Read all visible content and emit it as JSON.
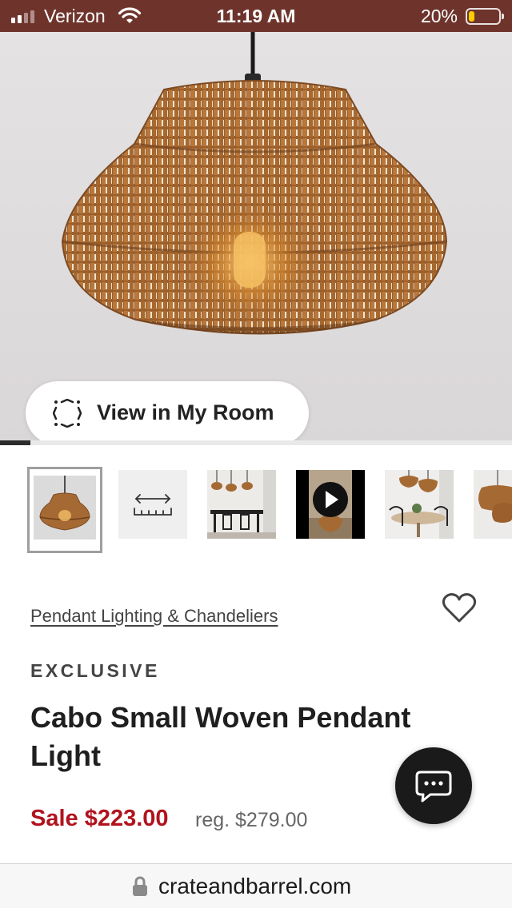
{
  "status_bar": {
    "carrier": "Verizon",
    "time": "11:19 AM",
    "battery_percent_text": "20%",
    "battery_level": 0.2,
    "signal_bars_active": 2,
    "signal_bars_total": 4
  },
  "hero": {
    "view_in_room_label": "View in My Room",
    "gallery_progress": 0.06
  },
  "thumbnails": [
    {
      "name": "thumbnail-pendant-product",
      "selected": true
    },
    {
      "name": "thumbnail-dimensions",
      "selected": false
    },
    {
      "name": "thumbnail-dining-room-pendants",
      "selected": false
    },
    {
      "name": "thumbnail-video",
      "selected": false
    },
    {
      "name": "thumbnail-dining-table-pendants",
      "selected": false
    },
    {
      "name": "thumbnail-pendant-partial",
      "selected": false
    }
  ],
  "product": {
    "breadcrumb": "Pendant Lighting & Chandeliers",
    "badge": "EXCLUSIVE",
    "title": "Cabo Small Woven Pendant Light",
    "sale_price": "Sale $223.00",
    "regular_price": "reg. $279.00"
  },
  "browser": {
    "url": "crateandbarrel.com"
  },
  "icons": {
    "heart": "heart-icon",
    "chat": "chat-icon",
    "lock": "lock-icon",
    "ar": "ar-view-icon",
    "play": "play-icon",
    "wifi": "wifi-icon"
  },
  "colors": {
    "status_bar": "#6e342c",
    "sale_price": "#b0131e",
    "chat_button": "#1a1a1a"
  }
}
